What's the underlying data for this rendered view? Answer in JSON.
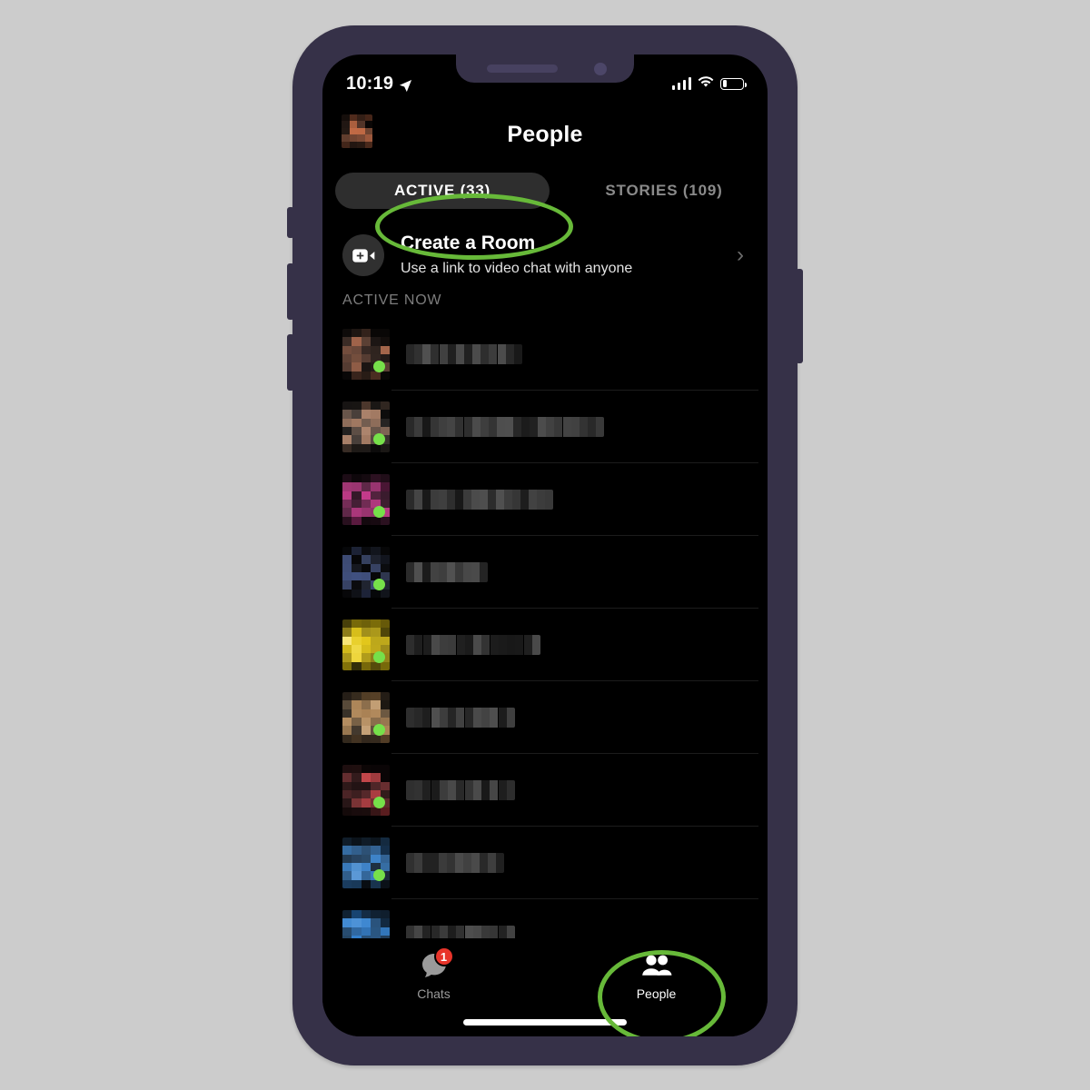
{
  "app": {
    "background_color": "#cccccc",
    "frame_color": "#363148",
    "screen_background": "#000000",
    "accent_green": "#67b939",
    "badge_red": "#e8342a",
    "active_dot_green": "#76e04a"
  },
  "status_bar": {
    "time": "10:19",
    "location_icon": "location-arrow-icon",
    "signal_icon": "cellular-signal-icon",
    "signal_bars": 4,
    "wifi_icon": "wifi-icon",
    "battery_icon": "battery-low-icon",
    "battery_level_percent": 22
  },
  "header": {
    "title": "People",
    "profile_avatar": "user-avatar-censored"
  },
  "segmented_control": {
    "selected_index": 0,
    "tabs": [
      {
        "label": "ACTIVE (33)",
        "selected": true
      },
      {
        "label": "STORIES (109)",
        "selected": false
      }
    ]
  },
  "create_room": {
    "icon": "video-camera-plus-icon",
    "title": "Create a Room",
    "subtitle": "Use a link to video chat with anyone",
    "chevron": "›"
  },
  "section": {
    "label": "ACTIVE NOW"
  },
  "active_now": {
    "items": [
      {
        "name": "",
        "name_redacted": true,
        "avatar_tone": "brown",
        "online": true
      },
      {
        "name": "",
        "name_redacted": true,
        "avatar_tone": "grey-brown",
        "online": true
      },
      {
        "name": "",
        "name_redacted": true,
        "avatar_tone": "magenta",
        "online": true
      },
      {
        "name": "",
        "name_redacted": true,
        "avatar_tone": "dark-navy",
        "online": true
      },
      {
        "name": "",
        "name_redacted": true,
        "avatar_tone": "yellow",
        "online": true
      },
      {
        "name": "",
        "name_redacted": true,
        "avatar_tone": "tan",
        "online": true
      },
      {
        "name": "",
        "name_redacted": true,
        "avatar_tone": "red",
        "online": true
      },
      {
        "name": "",
        "name_redacted": true,
        "avatar_tone": "blue",
        "online": true
      },
      {
        "name": "",
        "name_redacted": true,
        "avatar_tone": "blue-partial",
        "online": true
      }
    ]
  },
  "tab_bar": {
    "selected": "People",
    "items": [
      {
        "label": "Chats",
        "icon": "chat-bubble-icon",
        "badge": "1",
        "selected": false
      },
      {
        "label": "People",
        "icon": "people-icon",
        "badge": "",
        "selected": true
      }
    ]
  },
  "annotations": [
    {
      "target": "ACTIVE (33)",
      "shape": "ellipse",
      "color": "#67b939"
    },
    {
      "target": "People",
      "shape": "ellipse",
      "color": "#67b939"
    }
  ]
}
